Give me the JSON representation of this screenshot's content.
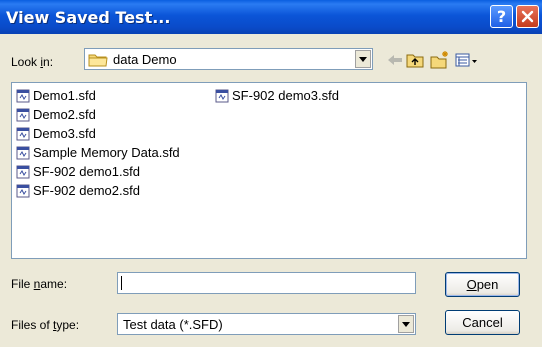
{
  "window": {
    "title": "View Saved Test..."
  },
  "toolbar": {
    "look_in_label": "Look in:",
    "look_in_value": "data Demo"
  },
  "files": [
    {
      "name": "Demo1.sfd"
    },
    {
      "name": "Demo2.sfd"
    },
    {
      "name": "Demo3.sfd"
    },
    {
      "name": "Sample Memory Data.sfd"
    },
    {
      "name": "SF-902 demo1.sfd"
    },
    {
      "name": "SF-902 demo2.sfd"
    },
    {
      "name": "SF-902 demo3.sfd"
    }
  ],
  "form": {
    "file_name_label": "File name:",
    "file_name_value": "",
    "file_type_label": "Files of type:",
    "file_type_value": "Test data (*.SFD)"
  },
  "buttons": {
    "open": "Open",
    "cancel": "Cancel"
  },
  "colors": {
    "title_bar": "#0a55d8",
    "dialog_bg": "#ece9d8",
    "close_button": "#c43b1c",
    "help_button": "#1f5fe6"
  }
}
